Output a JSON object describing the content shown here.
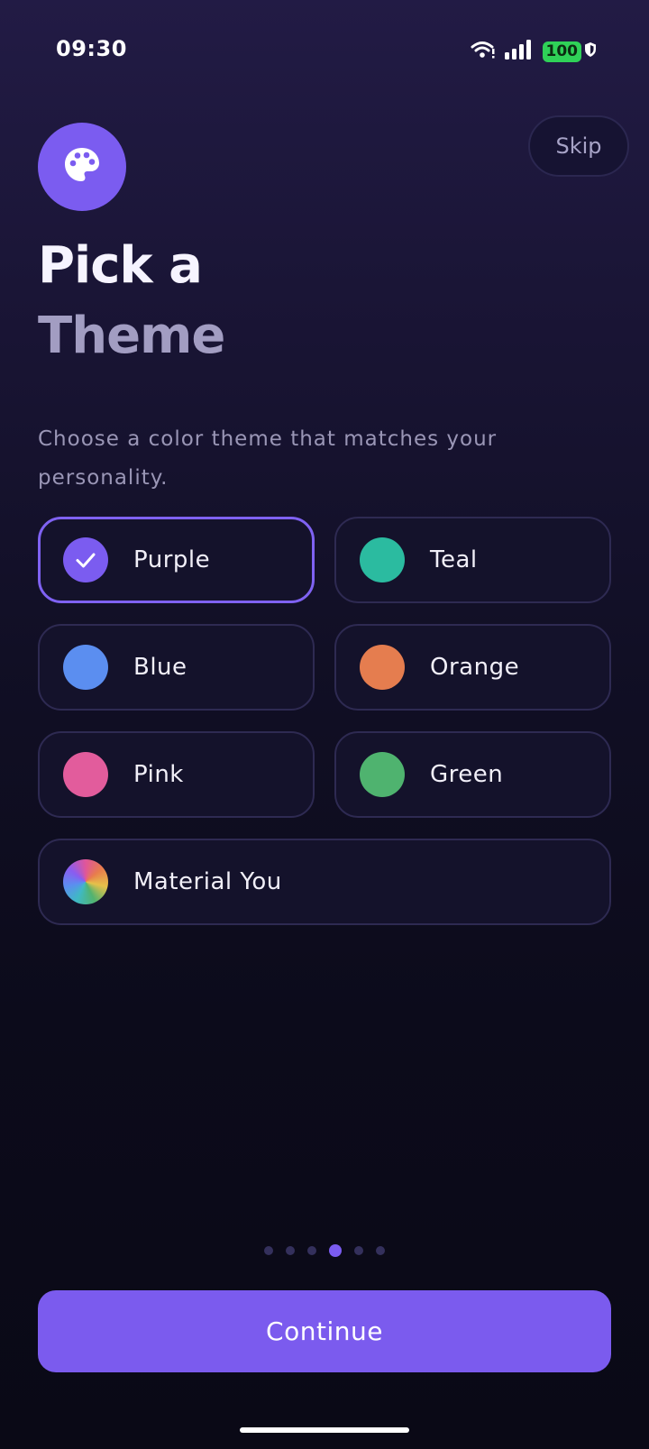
{
  "status_bar": {
    "time": "09:30",
    "battery_level": "100",
    "icons": [
      "wifi-icon",
      "signal-icon",
      "battery-icon",
      "shield-icon"
    ]
  },
  "header": {
    "skip_label": "Skip",
    "icon": "palette-icon",
    "title_line1": "Pick a",
    "title_line2": "Theme",
    "subtitle": "Choose a color theme that matches your personality."
  },
  "themes": [
    {
      "label": "Purple",
      "color": "#7b5cf0",
      "selected": true
    },
    {
      "label": "Teal",
      "color": "#2bbba0",
      "selected": false
    },
    {
      "label": "Blue",
      "color": "#5b8ef0",
      "selected": false
    },
    {
      "label": "Orange",
      "color": "#e57d4f",
      "selected": false
    },
    {
      "label": "Pink",
      "color": "#e25c9c",
      "selected": false
    },
    {
      "label": "Green",
      "color": "#4fb36f",
      "selected": false
    },
    {
      "label": "Material You",
      "color": "conic-gradient",
      "selected": false
    }
  ],
  "pagination": {
    "total": 6,
    "current": 4
  },
  "footer": {
    "continue_label": "Continue"
  },
  "colors": {
    "accent": "#7b5cf0",
    "battery": "#2fd158"
  }
}
